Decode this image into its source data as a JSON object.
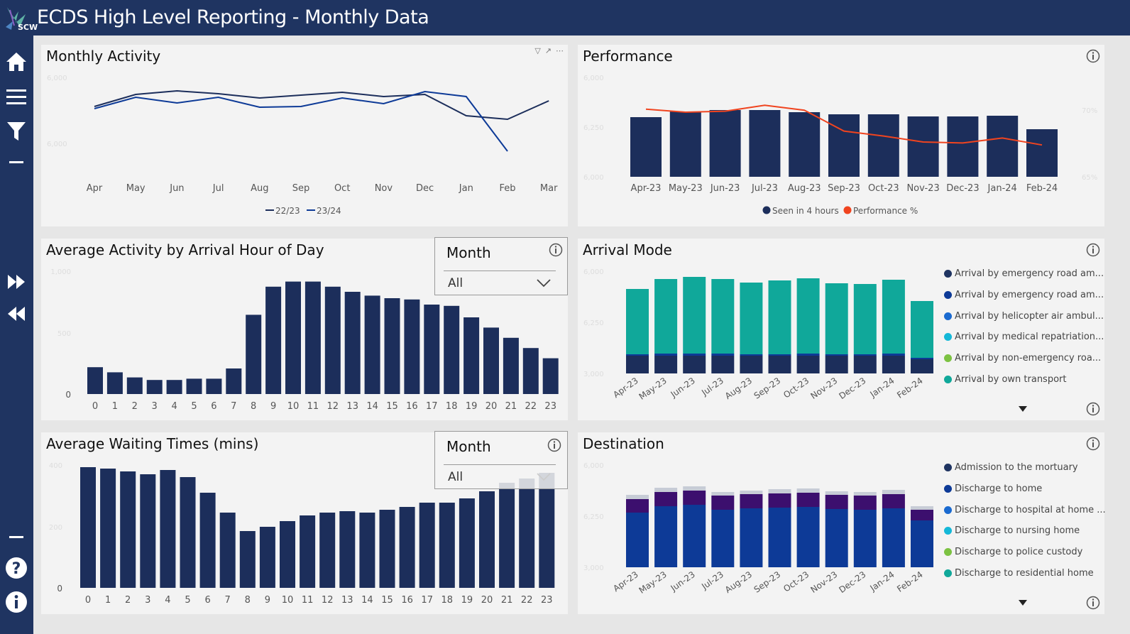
{
  "app": {
    "title": "ECDS High Level Reporting - Monthly Data",
    "logo_text": "SCW"
  },
  "sidebar": {
    "items": [
      {
        "name": "home-icon"
      },
      {
        "name": "menu-icon"
      },
      {
        "name": "filter-icon"
      },
      {
        "name": "minus-icon"
      },
      {
        "name": "fast-forward-icon"
      },
      {
        "name": "rewind-icon"
      },
      {
        "name": "minus-icon"
      },
      {
        "name": "help-icon"
      },
      {
        "name": "info-icon"
      }
    ]
  },
  "colors": {
    "navy": "#1f3461",
    "bar": "#1c2e5b",
    "red": "#f0441f",
    "teal": "#10a89a",
    "purple": "#3c0f6e",
    "blue": "#0d3a97"
  },
  "panels": {
    "monthly": {
      "title": "Monthly Activity",
      "chart_data": {
        "type": "line",
        "categories": [
          "Apr",
          "May",
          "Jun",
          "Jul",
          "Aug",
          "Sep",
          "Oct",
          "Nov",
          "Dec",
          "Jan",
          "Feb",
          "Mar"
        ],
        "y_ticks": [
          "6,000",
          "6,000"
        ],
        "series": [
          {
            "name": "22/23",
            "values": [
              0.32,
              0.15,
              0.1,
              0.14,
              0.2,
              0.16,
              0.12,
              0.18,
              0.15,
              0.45,
              0.5,
              0.24
            ]
          },
          {
            "name": "23/24",
            "values": [
              0.35,
              0.19,
              0.27,
              0.19,
              0.33,
              0.32,
              0.2,
              0.28,
              0.11,
              0.18,
              0.95,
              null
            ]
          }
        ],
        "legend": [
          "22/23",
          "23/24"
        ]
      }
    },
    "performance": {
      "title": "Performance",
      "chart_data": {
        "type": "bar",
        "categories": [
          "Apr-23",
          "May-23",
          "Jun-23",
          "Jul-23",
          "Aug-23",
          "Sep-23",
          "Oct-23",
          "Nov-23",
          "Dec-23",
          "Jan-24",
          "Feb-24"
        ],
        "y_ticks": [
          "6,000",
          "6,250",
          "6,000"
        ],
        "y2_ticks": [
          "70%",
          "65%"
        ],
        "series": [
          {
            "name": "Seen in 4 hours",
            "values": [
              84,
              92,
              94,
              94,
              91,
              88,
              88,
              85,
              85,
              86,
              67
            ]
          },
          {
            "name": "Performance %",
            "values": [
              74.0,
              72.5,
              73.0,
              76.0,
              73.5,
              63.0,
              60.5,
              57.5,
              57.0,
              59.5,
              56.0
            ]
          }
        ],
        "legend": [
          "Seen in 4 hours",
          "Performance %"
        ]
      }
    },
    "hourly": {
      "title": "Average Activity by Arrival Hour of Day",
      "slicer": {
        "label": "Month",
        "value": "All"
      },
      "chart_data": {
        "type": "bar",
        "categories": [
          "0",
          "1",
          "2",
          "3",
          "4",
          "5",
          "6",
          "7",
          "8",
          "9",
          "10",
          "11",
          "12",
          "13",
          "14",
          "15",
          "16",
          "17",
          "18",
          "19",
          "20",
          "21",
          "22",
          "23"
        ],
        "y_ticks": [
          "0",
          "500",
          "1,000"
        ],
        "values": [
          21,
          17,
          13,
          11,
          11,
          12,
          12,
          20,
          62,
          84,
          88,
          88,
          84,
          80,
          77,
          75,
          74,
          70,
          69,
          60,
          52,
          44,
          36,
          28
        ]
      }
    },
    "arrival": {
      "title": "Arrival Mode",
      "chart_data": {
        "type": "bar",
        "stacked": true,
        "categories": [
          "Apr-23",
          "May-23",
          "Jun-23",
          "Jul-23",
          "Aug-23",
          "Sep-23",
          "Oct-23",
          "Nov-23",
          "Dec-23",
          "Jan-24",
          "Feb-24"
        ],
        "y_ticks": [
          "6,000",
          "6,250",
          "3,000"
        ],
        "series": [
          {
            "name": "Arrival by emergency road am...",
            "values": [
              25,
              25,
              25,
              25,
              25,
              25,
              25,
              25,
              25,
              25,
              20
            ]
          },
          {
            "name": "Arrival by emergency road am...",
            "values": [
              2,
              3,
              3,
              3,
              2,
              2,
              3,
              2,
              2,
              3,
              2
            ]
          },
          {
            "name": "Arrival by helicopter air ambul...",
            "values": [
              0,
              0,
              0,
              0,
              0,
              0,
              0,
              0,
              0,
              0,
              0
            ]
          },
          {
            "name": "Arrival by medical repatriation...",
            "values": [
              0,
              0,
              0,
              0,
              0,
              0,
              0,
              0,
              0,
              0,
              0
            ]
          },
          {
            "name": "Arrival by non-emergency roa...",
            "values": [
              0,
              0,
              0,
              0,
              0,
              0,
              0,
              0,
              0,
              0,
              0
            ]
          },
          {
            "name": "Arrival by own transport",
            "values": [
              92,
              105,
              108,
              105,
              101,
              104,
              106,
              100,
              99,
              104,
              80
            ]
          }
        ]
      }
    },
    "waiting": {
      "title": "Average Waiting Times (mins)",
      "slicer": {
        "label": "Month",
        "value": "All"
      },
      "chart_data": {
        "type": "bar",
        "categories": [
          "0",
          "1",
          "2",
          "3",
          "4",
          "5",
          "6",
          "7",
          "8",
          "9",
          "10",
          "11",
          "12",
          "13",
          "14",
          "15",
          "16",
          "17",
          "18",
          "19",
          "20",
          "21",
          "22",
          "23"
        ],
        "y_ticks": [
          "0",
          "200",
          "400"
        ],
        "values": [
          85,
          84,
          82,
          80,
          83,
          78,
          67,
          53,
          40,
          43,
          47,
          51,
          53,
          54,
          53,
          55,
          57,
          60,
          60,
          63,
          68,
          74,
          77,
          81
        ]
      }
    },
    "destination": {
      "title": "Destination",
      "chart_data": {
        "type": "bar",
        "stacked": true,
        "categories": [
          "Apr-23",
          "May-23",
          "Jun-23",
          "Jul-23",
          "Aug-23",
          "Sep-23",
          "Oct-23",
          "Nov-23",
          "Dec-23",
          "Jan-24",
          "Feb-24"
        ],
        "y_ticks": [
          "6,000",
          "6,250",
          "3,000"
        ],
        "series": [
          {
            "name": "Admission to the mortuary",
            "values": [
              0,
              0,
              0,
              0,
              0,
              0,
              0,
              0,
              0,
              0,
              0
            ]
          },
          {
            "name": "Discharge to home",
            "values": [
              77,
              86,
              88,
              81,
              83,
              84,
              85,
              82,
              81,
              83,
              66
            ]
          },
          {
            "name": "Discharge to hospital at home ...",
            "values": [
              0,
              0,
              0,
              0,
              0,
              0,
              0,
              0,
              0,
              0,
              0
            ]
          },
          {
            "name": "Discharge to nursing home",
            "values": [
              0,
              0,
              0,
              0,
              0,
              0,
              0,
              0,
              0,
              0,
              0
            ]
          },
          {
            "name": "Discharge to police custody",
            "values": [
              0,
              0,
              0,
              0,
              0,
              0,
              0,
              0,
              0,
              0,
              0
            ]
          },
          {
            "name": "Discharge to residential home",
            "values": [
              0,
              0,
              0,
              0,
              0,
              0,
              0,
              0,
              0,
              0,
              0
            ]
          },
          {
            "name": "other-purple",
            "values": [
              19,
              20,
              20,
              20,
              20,
              20,
              20,
              20,
              20,
              20,
              15
            ]
          },
          {
            "name": "other-grey",
            "values": [
              6,
              6,
              6,
              5,
              5,
              6,
              6,
              5,
              5,
              6,
              5
            ]
          }
        ]
      }
    }
  }
}
